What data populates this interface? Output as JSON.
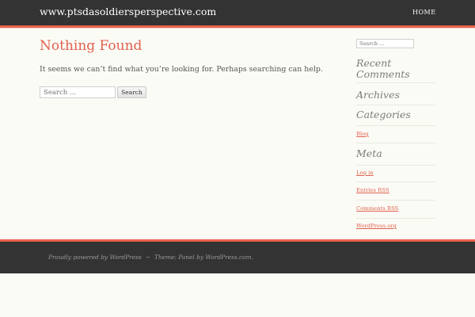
{
  "header": {
    "site_title": "www.ptsdasoldiersperspective.com",
    "nav": {
      "home": "HOME"
    }
  },
  "main": {
    "title": "Nothing Found",
    "message": "It seems we can’t find what you’re looking for. Perhaps searching can help.",
    "search": {
      "placeholder": "Search …",
      "button_label": "Search"
    }
  },
  "sidebar": {
    "search_placeholder": "Search …",
    "recent_comments_title": "Recent Comments",
    "archives_title": "Archives",
    "categories_title": "Categories",
    "categories": [
      "Blog"
    ],
    "meta_title": "Meta",
    "meta_links": [
      "Log in",
      "Entries RSS",
      "Comments RSS",
      "WordPress.org"
    ]
  },
  "footer": {
    "powered_by": "Proudly powered by WordPress",
    "separator": "~",
    "theme_credit": "Theme: Panel by WordPress.com."
  },
  "colors": {
    "accent": "#e8624c",
    "bar_background": "#333333",
    "page_background": "#fbfbf6"
  }
}
